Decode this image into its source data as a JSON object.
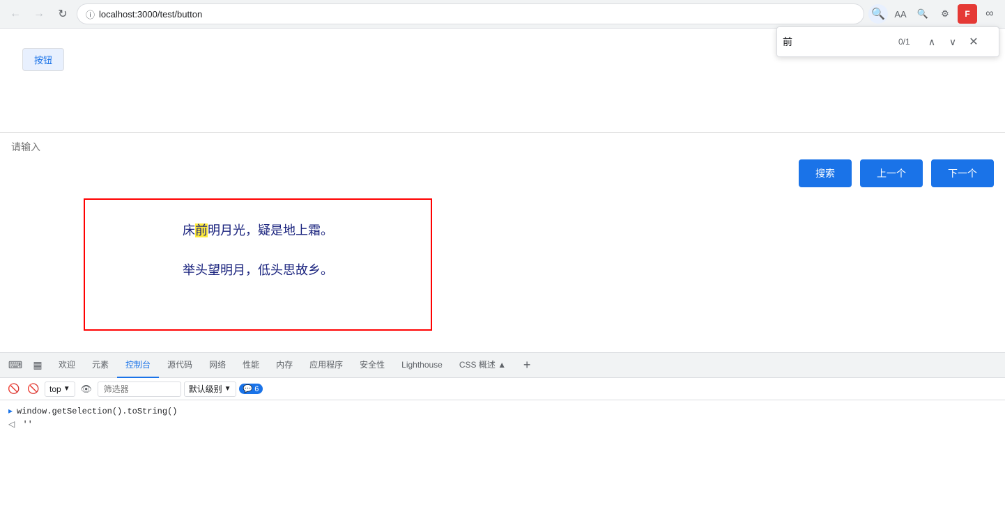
{
  "browser": {
    "back_btn": "←",
    "forward_btn": "→",
    "reload_btn": "↺",
    "url": "localhost:3000/test/button",
    "find_btn_icon": "🔍",
    "find_input_value": "前",
    "find_count": "0/1"
  },
  "findbar": {
    "input_placeholder": "前",
    "count": "0/1",
    "up_icon": "∧",
    "down_icon": "∨",
    "close_icon": "✕"
  },
  "page": {
    "button_label": "按钮",
    "input_placeholder": "请输入",
    "search_btn": "搜索",
    "prev_btn": "上一个",
    "next_btn": "下一个",
    "poem_line1_prefix": "床",
    "poem_line1_highlight": "前",
    "poem_line1_suffix": "明月光，疑是地上霜。",
    "poem_line2": "举头望明月，低头思故乡。"
  },
  "devtools": {
    "tabs": [
      {
        "id": "welcome",
        "label": "欢迎"
      },
      {
        "id": "elements",
        "label": "元素"
      },
      {
        "id": "console",
        "label": "控制台",
        "active": true
      },
      {
        "id": "sources",
        "label": "源代码"
      },
      {
        "id": "network",
        "label": "网络"
      },
      {
        "id": "performance",
        "label": "性能"
      },
      {
        "id": "memory",
        "label": "内存"
      },
      {
        "id": "application",
        "label": "应用程序"
      },
      {
        "id": "security",
        "label": "安全性"
      },
      {
        "id": "lighthouse",
        "label": "Lighthouse"
      },
      {
        "id": "css-overview",
        "label": "CSS 概述 ▲"
      }
    ],
    "console_toolbar": {
      "top_selector": "top",
      "filter_placeholder": "筛选器",
      "level_label": "默认级别",
      "badge_count": "6"
    },
    "console_output": [
      {
        "type": "code",
        "text": "window.getSelection().toString()"
      },
      {
        "type": "result",
        "text": "''"
      }
    ]
  }
}
